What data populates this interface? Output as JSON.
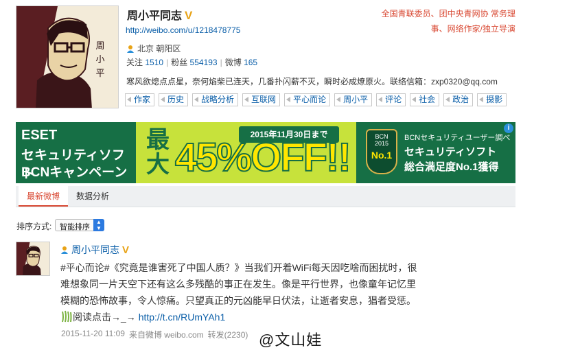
{
  "profile": {
    "name": "周小平同志",
    "verified_badge": "V",
    "url": "http://weibo.com/u/1218478775",
    "location": "北京 朝阳区",
    "follow_label": "关注",
    "follow_count": "1510",
    "fans_label": "粉丝",
    "fans_count": "554193",
    "weibo_label": "微博",
    "weibo_count": "165",
    "description": "寒风欲熄点点星，奈何焰柴已连天，几番扑闪薪不灭，瞬时必成燎原火。联络信箱：zxp0320@qq.com",
    "title_line1": "全国青联委员、团中央青网协 常务理",
    "title_line2": "事、网络作家/独立导演",
    "tags": [
      "作家",
      "历史",
      "战略分析",
      "互联网",
      "平心而论",
      "周小平",
      "评论",
      "社会",
      "政治",
      "摄影"
    ],
    "avatar_signature": "周小平"
  },
  "ad": {
    "left_line1": "ESET",
    "left_line2": "セキュリティソフト",
    "left_line3": "BCNキャンペーン",
    "big1": "最",
    "big2": "大",
    "percent": "45%OFF!!",
    "date": "2015年11月30日まで",
    "medal_top": "BCN",
    "medal_year": "2015",
    "medal_rank": "No.1",
    "right_line1": "BCNセキュリティユーザー調べ",
    "right_line2": "セキュリティソフト",
    "right_line3": "総合満足度No.1獲得",
    "info_icon": "i"
  },
  "tabs": {
    "active": "最新微博",
    "other": "数据分析"
  },
  "sort": {
    "label": "排序方式:",
    "selected": "智能排序"
  },
  "post": {
    "author": "周小平同志",
    "verified_badge": "V",
    "line1": "#平心而论#《究竟是谁害死了中国人质？》当我们开着WiFi每天因吃啥而困扰时，很",
    "line2": "难想象同一片天空下还有这么多残酷的事正在发生。像是平行世界，也像童年记忆里",
    "line3": "模糊的恐怖故事，令人惊痛。只望真正的元凶能早日伏法，让逝者安息，猖者受惩。",
    "read_text": "阅读点击→_→",
    "link": "http://t.cn/RUmYAh1",
    "timestamp": "2015-11-20 11:09",
    "source": "来自微博 weibo.com",
    "repost": "转发(2230)"
  },
  "watermark": "@文山娃",
  "colors": {
    "link": "#0a5ea8",
    "accent_red": "#d94a34",
    "verified": "#e8a317",
    "ad_green": "#166f45",
    "ad_lime": "#c7e23b"
  }
}
